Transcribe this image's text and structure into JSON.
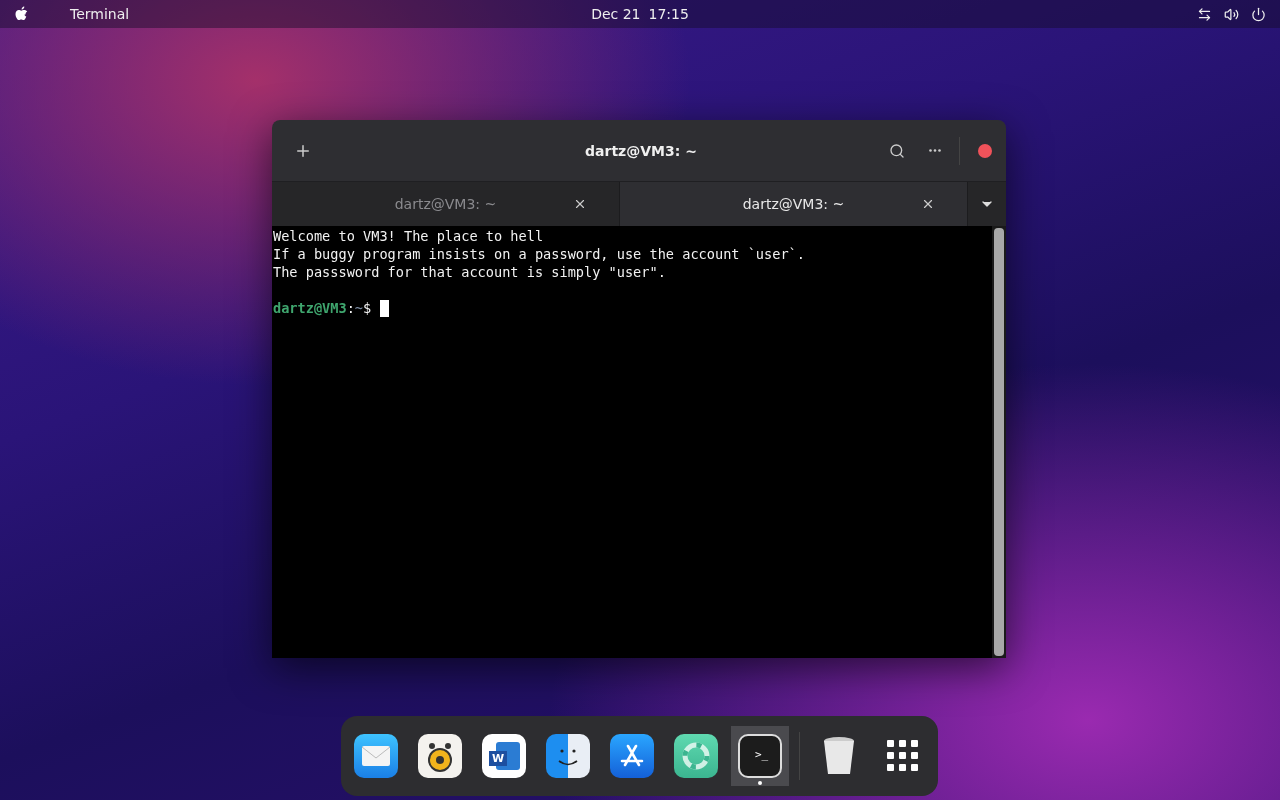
{
  "top_bar": {
    "app_name": "Terminal",
    "date": "Dec 21",
    "time": "17:15"
  },
  "window": {
    "title": "dartz@VM3: ~",
    "tabs": [
      {
        "label": "dartz@VM3: ~",
        "selected": false
      },
      {
        "label": "dartz@VM3: ~",
        "selected": true
      }
    ],
    "output": [
      "Welcome to VM3! The place to hell",
      "If a buggy program insists on a password, use the account `user`.",
      "The passsword for that account is simply \"user\"."
    ],
    "prompt": {
      "user_host": "dartz@VM3",
      "separator": ":",
      "path": "~",
      "symbol": "$"
    }
  },
  "dock": {
    "items": [
      {
        "kind": "mail",
        "running": false
      },
      {
        "kind": "music",
        "running": false
      },
      {
        "kind": "word",
        "glyph": "W",
        "running": false
      },
      {
        "kind": "finder",
        "running": false
      },
      {
        "kind": "appstore",
        "running": false
      },
      {
        "kind": "help",
        "running": false
      },
      {
        "kind": "terminal",
        "glyph": ">_",
        "running": true
      },
      {
        "kind": "separator"
      },
      {
        "kind": "trash",
        "running": false
      },
      {
        "kind": "apps",
        "running": false
      }
    ]
  }
}
